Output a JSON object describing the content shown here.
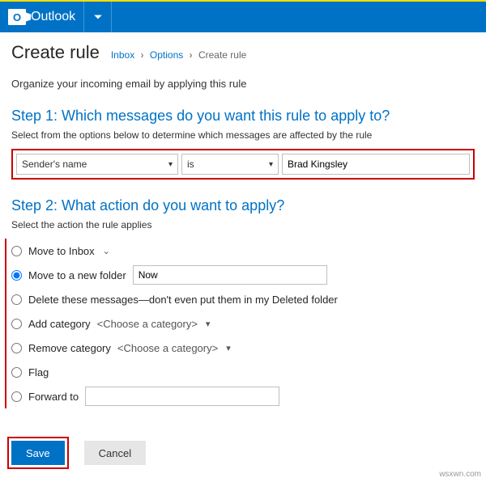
{
  "app": {
    "name": "Outlook",
    "logo_letter": "O"
  },
  "breadcrumb": {
    "a": "Inbox",
    "b": "Options",
    "c": "Create rule"
  },
  "page_title": "Create rule",
  "intro": "Organize your incoming email by applying this rule",
  "step1": {
    "heading": "Step 1: Which messages do you want this rule to apply to?",
    "sub": "Select from the options below to determine which messages are affected by the rule",
    "field": "Sender's name",
    "operator": "is",
    "value": "Brad Kingsley"
  },
  "step2": {
    "heading": "Step 2: What action do you want to apply?",
    "sub": "Select the action the rule applies",
    "options": {
      "move_inbox": "Move to Inbox",
      "move_new": "Move to a new folder",
      "move_new_value": "Now",
      "delete": "Delete these messages—don't even put them in my Deleted folder",
      "add_cat": "Add category",
      "rem_cat": "Remove category",
      "cat_placeholder": "<Choose a category>",
      "flag": "Flag",
      "forward": "Forward to"
    }
  },
  "buttons": {
    "save": "Save",
    "cancel": "Cancel"
  },
  "watermark": "wsxwn.com"
}
